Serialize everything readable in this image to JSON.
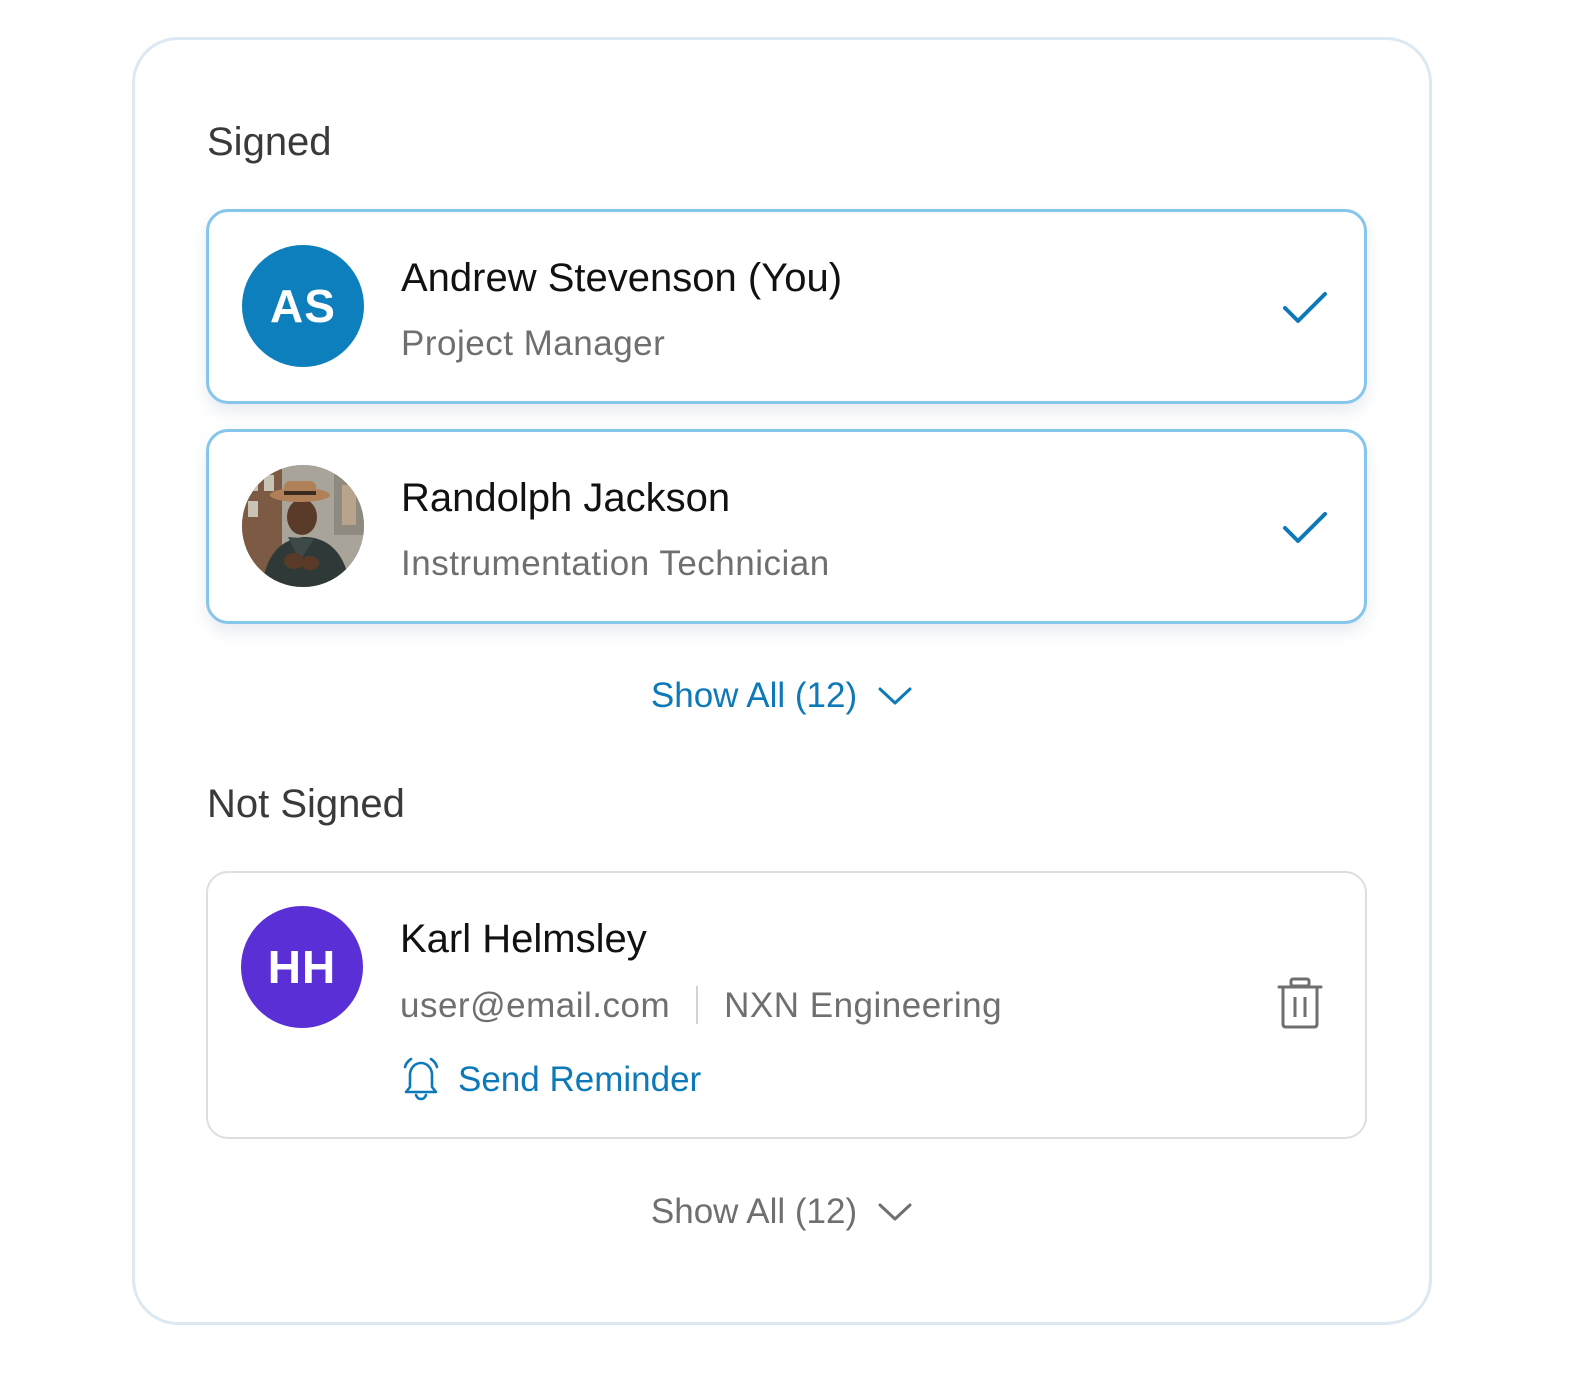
{
  "signed_section": {
    "title": "Signed",
    "signers": [
      {
        "initials": "AS",
        "name": "Andrew Stevenson (You)",
        "role": "Project Manager",
        "avatar_color": "#0e7fbd",
        "status_icon": "check-icon"
      },
      {
        "name": "Randolph Jackson",
        "role": "Instrumentation Technician",
        "avatar": "photo",
        "status_icon": "check-icon"
      }
    ],
    "show_all_label": "Show All (12)",
    "show_all_color": "#0e79b8"
  },
  "not_signed_section": {
    "title": "Not Signed",
    "signers": [
      {
        "initials": "HH",
        "name": "Karl Helmsley",
        "email": "user@email.com",
        "company": "NXN Engineering",
        "avatar_color": "#5b2fd6",
        "reminder_label": "Send Reminder",
        "reminder_icon": "bell-icon",
        "delete_icon": "trash-icon"
      }
    ],
    "show_all_label": "Show All (12)",
    "show_all_color": "#6f6f6f"
  }
}
